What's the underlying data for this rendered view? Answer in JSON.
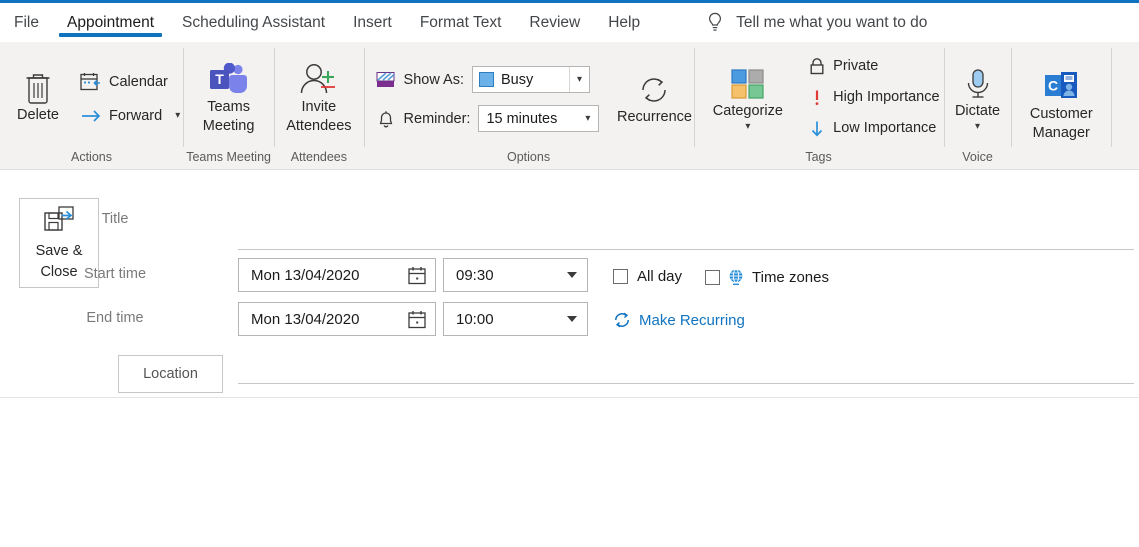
{
  "window": {
    "accent_color": "#1073BF",
    "ribbon_bg": "#f3f2f1"
  },
  "tabs": [
    {
      "label": "File",
      "active": false
    },
    {
      "label": "Appointment",
      "active": true
    },
    {
      "label": "Scheduling Assistant",
      "active": false
    },
    {
      "label": "Insert",
      "active": false
    },
    {
      "label": "Format Text",
      "active": false
    },
    {
      "label": "Review",
      "active": false
    },
    {
      "label": "Help",
      "active": false
    }
  ],
  "tell_me": {
    "label": "Tell me what you want to do",
    "icon": "lightbulb-icon"
  },
  "ribbon": {
    "groups": [
      {
        "name": "actions",
        "label": "Actions",
        "items": [
          {
            "label": "Delete",
            "icon": "trash-icon"
          },
          {
            "label": "Calendar",
            "icon": "calendar-arrow-icon"
          },
          {
            "label": "Forward",
            "icon": "arrow-right-icon",
            "has_dropdown": true
          }
        ]
      },
      {
        "name": "teams-meeting",
        "label": "Teams Meeting",
        "items": [
          {
            "label": "Teams",
            "label2": "Meeting",
            "icon": "teams-icon"
          }
        ]
      },
      {
        "name": "attendees",
        "label": "Attendees",
        "items": [
          {
            "label": "Invite",
            "label2": "Attendees",
            "icon": "add-person-icon"
          }
        ]
      },
      {
        "name": "options",
        "label": "Options",
        "items": [
          {
            "label": "Show As:",
            "icon": "show-as-icon",
            "value": "Busy",
            "value_color": "#6CB1E8"
          },
          {
            "label": "Reminder:",
            "icon": "bell-icon",
            "value": "15 minutes"
          },
          {
            "label": "Recurrence",
            "icon": "recurrence-icon"
          }
        ]
      },
      {
        "name": "tags",
        "label": "Tags",
        "items": [
          {
            "label": "Categorize",
            "icon": "categorize-icon",
            "has_dropdown": true,
            "colors": [
              "#4A9BE0",
              "#ACACAC",
              "#F5C26B",
              "#76C793"
            ]
          },
          {
            "label": "Private",
            "icon": "lock-icon"
          },
          {
            "label": "High Importance",
            "icon": "exclamation-icon",
            "color": "#E03A35"
          },
          {
            "label": "Low Importance",
            "icon": "arrow-down-icon",
            "color": "#2B8FD9"
          }
        ]
      },
      {
        "name": "voice",
        "label": "Voice",
        "items": [
          {
            "label": "Dictate",
            "icon": "microphone-icon",
            "has_dropdown": true
          }
        ]
      },
      {
        "name": "customer-manager",
        "label": "",
        "items": [
          {
            "label": "Customer",
            "label2": "Manager",
            "icon": "outlook-customer-manager-icon"
          }
        ]
      }
    ]
  },
  "form": {
    "save_close": {
      "label": "Save &",
      "label2": "Close",
      "icon": "save-close-icon"
    },
    "title": {
      "label": "Title",
      "value": "",
      "placeholder": ""
    },
    "start_time": {
      "label": "Start time",
      "date": "Mon 13/04/2020",
      "time": "09:30",
      "date_icon": "calendar-picker-icon"
    },
    "end_time": {
      "label": "End time",
      "date": "Mon 13/04/2020",
      "time": "10:00",
      "date_icon": "calendar-picker-icon"
    },
    "all_day": {
      "label": "All day",
      "checked": false
    },
    "time_zones": {
      "label": "Time zones",
      "checked": false,
      "icon": "globe-icon"
    },
    "make_recurring": {
      "label": "Make Recurring",
      "icon": "recurrence-small-icon"
    },
    "location": {
      "label": "Location",
      "value": "",
      "placeholder": ""
    },
    "body": {
      "value": "",
      "placeholder": ""
    }
  }
}
